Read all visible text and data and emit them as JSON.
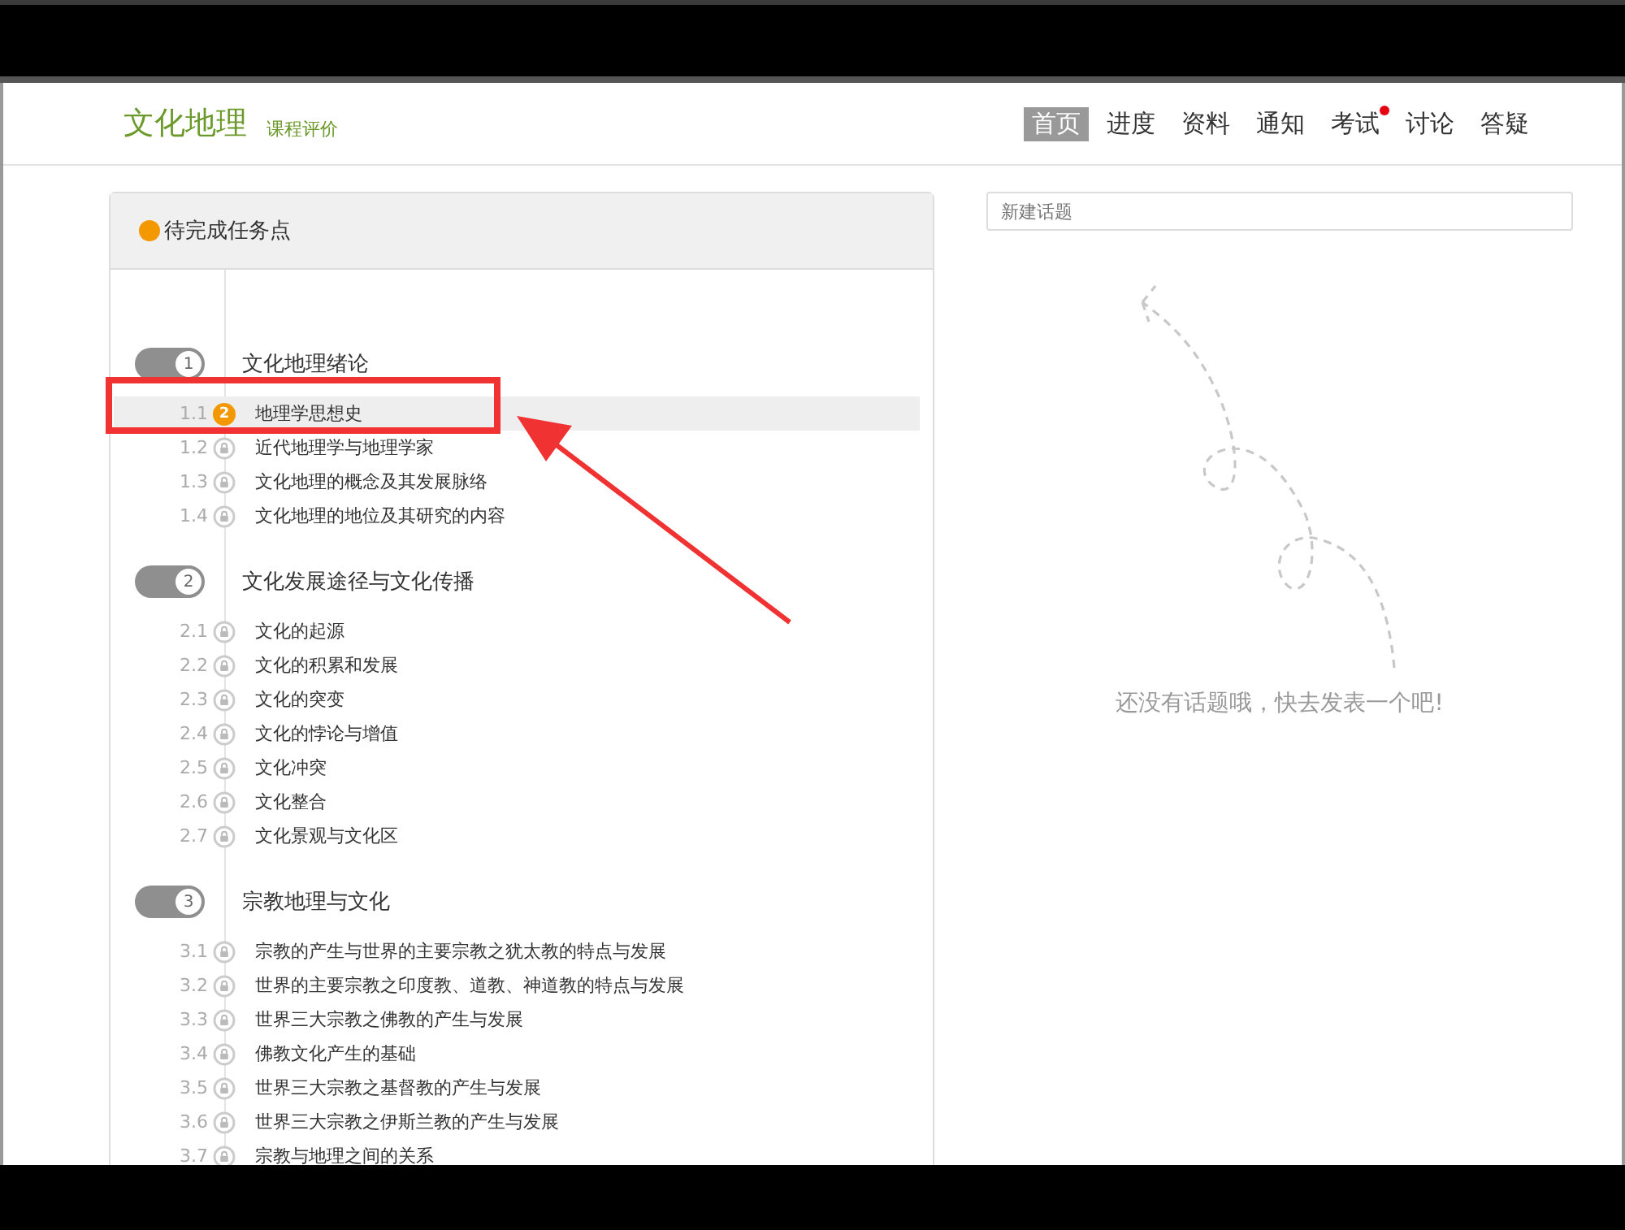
{
  "header": {
    "course_title": "文化地理",
    "rating_link": "课程评价",
    "nav": [
      {
        "label": "首页",
        "selected": true,
        "has_dot": false
      },
      {
        "label": "进度",
        "selected": false,
        "has_dot": false
      },
      {
        "label": "资料",
        "selected": false,
        "has_dot": false
      },
      {
        "label": "通知",
        "selected": false,
        "has_dot": false
      },
      {
        "label": "考试",
        "selected": false,
        "has_dot": true
      },
      {
        "label": "讨论",
        "selected": false,
        "has_dot": false
      },
      {
        "label": "答疑",
        "selected": false,
        "has_dot": false
      }
    ]
  },
  "tasks": {
    "title": "待完成任务点",
    "chapters": [
      {
        "number": "1",
        "title": "文化地理绪论",
        "lessons": [
          {
            "number": "1.1",
            "title": "地理学思想史",
            "kind": "tasks",
            "badge": "2",
            "selected": true
          },
          {
            "number": "1.2",
            "title": "近代地理学与地理学家",
            "kind": "locked",
            "selected": false
          },
          {
            "number": "1.3",
            "title": "文化地理的概念及其发展脉络",
            "kind": "locked",
            "selected": false
          },
          {
            "number": "1.4",
            "title": "文化地理的地位及其研究的内容",
            "kind": "locked",
            "selected": false
          }
        ]
      },
      {
        "number": "2",
        "title": "文化发展途径与文化传播",
        "lessons": [
          {
            "number": "2.1",
            "title": "文化的起源",
            "kind": "locked",
            "selected": false
          },
          {
            "number": "2.2",
            "title": "文化的积累和发展",
            "kind": "locked",
            "selected": false
          },
          {
            "number": "2.3",
            "title": "文化的突变",
            "kind": "locked",
            "selected": false
          },
          {
            "number": "2.4",
            "title": "文化的悖论与增值",
            "kind": "locked",
            "selected": false
          },
          {
            "number": "2.5",
            "title": "文化冲突",
            "kind": "locked",
            "selected": false
          },
          {
            "number": "2.6",
            "title": "文化整合",
            "kind": "locked",
            "selected": false
          },
          {
            "number": "2.7",
            "title": "文化景观与文化区",
            "kind": "locked",
            "selected": false
          }
        ]
      },
      {
        "number": "3",
        "title": "宗教地理与文化",
        "lessons": [
          {
            "number": "3.1",
            "title": "宗教的产生与世界的主要宗教之犹太教的特点与发展",
            "kind": "locked",
            "selected": false
          },
          {
            "number": "3.2",
            "title": "世界的主要宗教之印度教、道教、神道教的特点与发展",
            "kind": "locked",
            "selected": false
          },
          {
            "number": "3.3",
            "title": "世界三大宗教之佛教的产生与发展",
            "kind": "locked",
            "selected": false
          },
          {
            "number": "3.4",
            "title": "佛教文化产生的基础",
            "kind": "locked",
            "selected": false
          },
          {
            "number": "3.5",
            "title": "世界三大宗教之基督教的产生与发展",
            "kind": "locked",
            "selected": false
          },
          {
            "number": "3.6",
            "title": "世界三大宗教之伊斯兰教的产生与发展",
            "kind": "locked",
            "selected": false
          },
          {
            "number": "3.7",
            "title": "宗教与地理之间的关系",
            "kind": "locked",
            "selected": false
          }
        ]
      }
    ]
  },
  "discussion": {
    "placeholder": "新建话题",
    "empty_message": "还没有话题哦，快去发表一个吧!"
  }
}
